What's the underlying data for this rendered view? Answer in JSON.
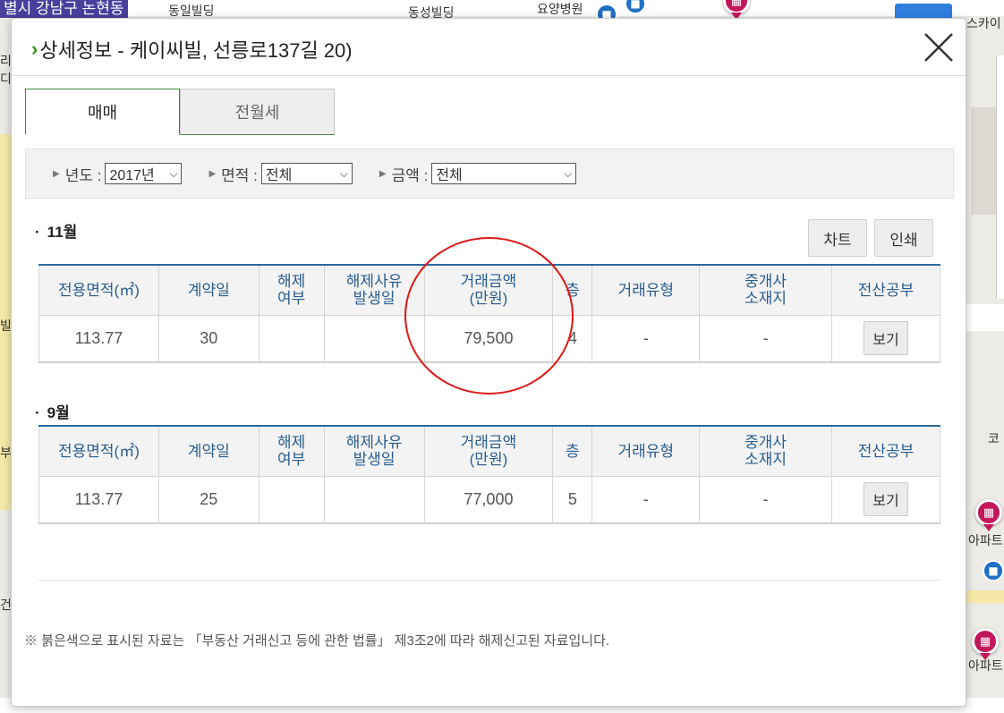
{
  "map": {
    "district_label": "별시 강남구 논현동",
    "labels": [
      "동일빌딩",
      "동성빌딩",
      "요양병원",
      "스카이",
      "코",
      "아파트",
      "아파트",
      "부",
      "건",
      "빌",
      "리",
      "디"
    ],
    "marker_icon": "apartment-icon",
    "bus_icon": "bus-icon"
  },
  "modal": {
    "title": "상세정보 - 케이씨빌, 선릉로137길 20)",
    "close_icon": "close-icon",
    "tabs": [
      {
        "label": "매매",
        "active": true
      },
      {
        "label": "전월세",
        "active": false
      }
    ],
    "filters": {
      "year": {
        "label": "년도 :",
        "value": "2017년"
      },
      "area": {
        "label": "면적 :",
        "value": "전체"
      },
      "price": {
        "label": "금액 :",
        "value": "전체"
      }
    },
    "buttons": {
      "chart": "차트",
      "print": "인쇄"
    },
    "columns": {
      "area": "전용면적(㎡)",
      "date": "계약일",
      "cancel_1": "해제",
      "cancel_2": "여부",
      "cancel_reason_1": "해제사유",
      "cancel_reason_2": "발생일",
      "price_1": "거래금액",
      "price_2": "(만원)",
      "floor": "층",
      "deal_type": "거래유형",
      "agent_1": "중개사",
      "agent_2": "소재지",
      "registry": "전산공부"
    },
    "sections": [
      {
        "label": "11월",
        "rows": [
          {
            "area": "113.77",
            "date": "30",
            "cancelled": "",
            "cancel_date": "",
            "price": "79,500",
            "floor": "4",
            "deal_type": "-",
            "agent": "-",
            "view_label": "보기"
          }
        ]
      },
      {
        "label": "9월",
        "rows": [
          {
            "area": "113.77",
            "date": "25",
            "cancelled": "",
            "cancel_date": "",
            "price": "77,000",
            "floor": "5",
            "deal_type": "-",
            "agent": "-",
            "view_label": "보기"
          }
        ]
      }
    ],
    "footnote": "※ 붉은색으로 표시된 자료는 「부동산 거래신고 등에 관한 법률」 제3조2에 따라 해제신고된 자료입니다.",
    "annotation_color": "#e01818"
  }
}
